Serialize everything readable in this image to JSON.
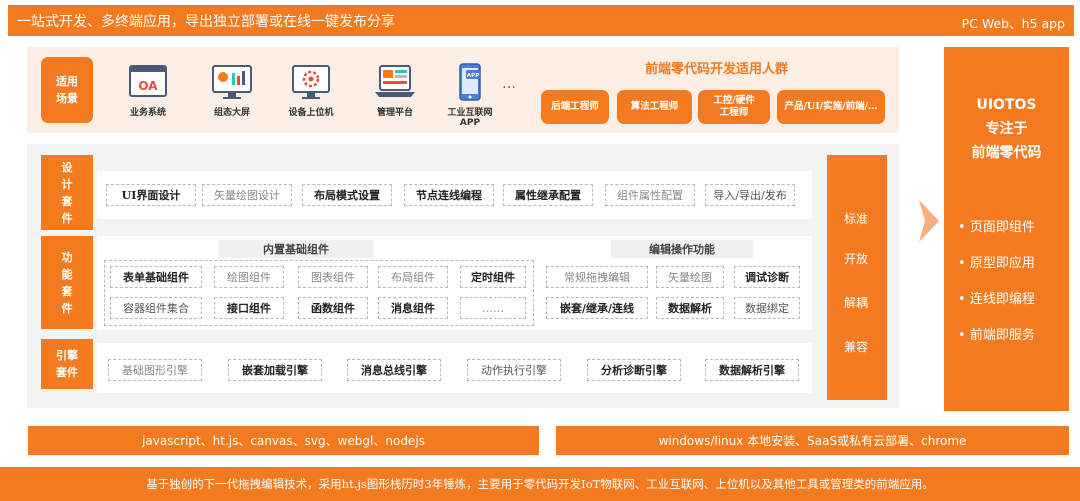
{
  "header": {
    "title": "一站式开发、多终端应用，导出独立部署或在线一键发布分享",
    "platforms": "PC Web、h5 app"
  },
  "scenarios": {
    "label": "适用\n场景",
    "items": [
      {
        "label": "业务系统",
        "icon": "oa-window-icon",
        "icon_text": "OA"
      },
      {
        "label": "组态大屏",
        "icon": "dashboard-monitor-icon"
      },
      {
        "label": "设备上位机",
        "icon": "device-monitor-icon"
      },
      {
        "label": "管理平台",
        "icon": "admin-laptop-icon"
      },
      {
        "label": "工业互联网\nAPP",
        "icon": "phone-app-icon",
        "icon_text": "APP"
      }
    ],
    "ellipsis": "…"
  },
  "audience": {
    "title": "前端零代码开发适用人群",
    "roles": [
      "后端工程师",
      "算法工程师",
      "工控/硬件\n工程师",
      "产品/UI/实施/前端/…"
    ]
  },
  "design_kit": {
    "label": "设\n计\n套\n件",
    "items": [
      {
        "text": "UI界面设计",
        "style": "bold"
      },
      {
        "text": "矢量绘图设计",
        "style": "light"
      },
      {
        "text": "布局模式设置",
        "style": "bold"
      },
      {
        "text": "节点连线编程",
        "style": "bold"
      },
      {
        "text": "属性继承配置",
        "style": "bold"
      },
      {
        "text": "组件属性配置",
        "style": "light"
      },
      {
        "text": "导入/导出/发布",
        "style": "normal"
      }
    ]
  },
  "function_kit": {
    "label": "功\n能\n套\n件",
    "builtin_title": "内置基础组件",
    "builtin_row1": [
      {
        "text": "表单基础组件",
        "style": "bold"
      },
      {
        "text": "绘图组件",
        "style": "light"
      },
      {
        "text": "图表组件",
        "style": "light"
      },
      {
        "text": "布局组件",
        "style": "light"
      },
      {
        "text": "定时组件",
        "style": "bold"
      }
    ],
    "builtin_row2": [
      {
        "text": "容器组件集合",
        "style": "normal"
      },
      {
        "text": "接口组件",
        "style": "bold"
      },
      {
        "text": "函数组件",
        "style": "bold"
      },
      {
        "text": "消息组件",
        "style": "bold"
      },
      {
        "text": "……",
        "style": "light"
      }
    ],
    "edit_title": "编辑操作功能",
    "edit_row1": [
      {
        "text": "常规拖拽编辑",
        "style": "light"
      },
      {
        "text": "矢量绘图",
        "style": "light"
      },
      {
        "text": "调试诊断",
        "style": "bold"
      }
    ],
    "edit_row2": [
      {
        "text": "嵌套/继承/连线",
        "style": "bold"
      },
      {
        "text": "数据解析",
        "style": "bold"
      },
      {
        "text": "数据绑定",
        "style": "normal"
      }
    ]
  },
  "engine_kit": {
    "label": "引擎\n套件",
    "items": [
      {
        "text": "基础图形引擎",
        "style": "light"
      },
      {
        "text": "嵌套加载引擎",
        "style": "bold"
      },
      {
        "text": "消息总线引擎",
        "style": "bold"
      },
      {
        "text": "动作执行引擎",
        "style": "normal"
      },
      {
        "text": "分析诊断引擎",
        "style": "bold"
      },
      {
        "text": "数据解析引擎",
        "style": "bold"
      }
    ]
  },
  "standards": [
    "标准",
    "开放",
    "解耦",
    "兼容"
  ],
  "right_panel": {
    "title": "UIOTOS\n专注于\n前端零代码",
    "bullets": [
      "页面即组件",
      "原型即应用",
      "连线即编程",
      "前端即服务"
    ]
  },
  "tech_bar": "javascript、ht.js、canvas、svg、webgl、nodejs",
  "deploy_bar": "windows/linux 本地安装、SaaS或私有云部署、chrome",
  "footer": "基于独创的下一代拖拽编辑技术，采用ht.js图形栈历时3年锤炼，主要用于零代码开发IoT物联网、工业互联网、上位机以及其他工具或管理类的前端应用。",
  "colors": {
    "accent": "#f47a1f",
    "light_panel": "#fbeee4",
    "gray_panel": "#f4f4f4"
  }
}
